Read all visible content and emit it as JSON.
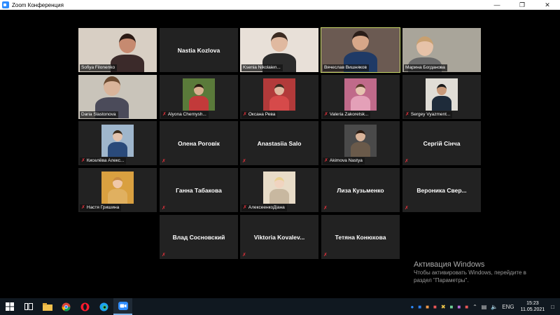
{
  "window": {
    "title": "Zoom Конференция"
  },
  "participants": [
    {
      "name": "Sofiya Filonenko",
      "video": true,
      "muted": false
    },
    {
      "name": "Nastia Kozlova",
      "video": false,
      "muted": false
    },
    {
      "name": "Ksenia Nikolaien...",
      "video": true,
      "muted": false
    },
    {
      "name": "Вячеслав Вишняков",
      "video": true,
      "muted": false,
      "active": true
    },
    {
      "name": "Марина Богданова",
      "video": true,
      "muted": false
    },
    {
      "name": "Daria Slastonova",
      "video": true,
      "muted": false
    },
    {
      "name": "Alyona Chernysh...",
      "video": true,
      "muted": true
    },
    {
      "name": "Оксана Рева",
      "video": true,
      "muted": true
    },
    {
      "name": "Valeria Zakoretsk...",
      "video": true,
      "muted": true
    },
    {
      "name": "Sergey Vyazment...",
      "video": true,
      "muted": true
    },
    {
      "name": "Киселёва Алекс...",
      "video": true,
      "muted": true
    },
    {
      "name": "Олена Роговік",
      "video": false,
      "muted": true
    },
    {
      "name": "Anastasiia Salo",
      "video": false,
      "muted": true
    },
    {
      "name": "Akimova Nastya",
      "video": true,
      "muted": true
    },
    {
      "name": "Сергій Сінча",
      "video": false,
      "muted": true
    },
    {
      "name": "Настя Гришина",
      "video": true,
      "muted": true
    },
    {
      "name": "Ганна Табакова",
      "video": false,
      "muted": true
    },
    {
      "name": "АлексеенкоДіана",
      "video": true,
      "muted": true
    },
    {
      "name": "Лиза Кузьменко",
      "video": false,
      "muted": true
    },
    {
      "name": "Вероника Свер...",
      "video": false,
      "muted": true
    },
    {
      "name": "Влад Сосновский",
      "video": false,
      "muted": true
    },
    {
      "name": "Viktoria Kovalev...",
      "video": false,
      "muted": true
    },
    {
      "name": "Тетяна Конюхова",
      "video": false,
      "muted": true
    }
  ],
  "watermark": {
    "title": "Активация Windows",
    "line1": "Чтобы активировать Windows, перейдите в",
    "line2": "раздел \"Параметры\"."
  },
  "taskbar": {
    "lang": "ENG",
    "time": "15:23",
    "date": "11.05.2021"
  },
  "icons": {
    "mic_muted": "🎙"
  }
}
